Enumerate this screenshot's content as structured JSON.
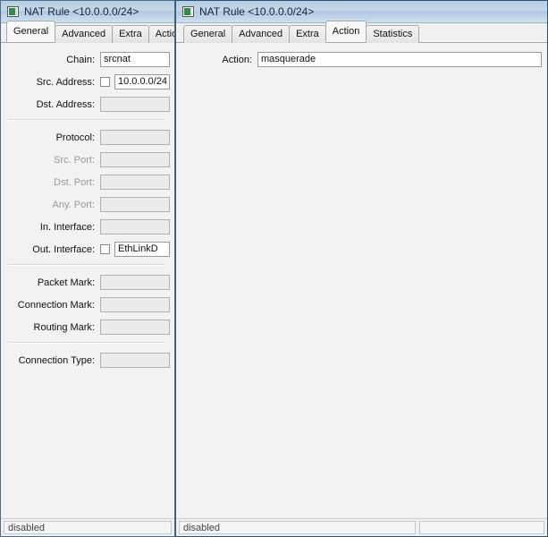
{
  "windows": {
    "left": {
      "title": "NAT Rule <10.0.0.0/24>",
      "icon": "window-icon",
      "tabs": [
        {
          "label": "General",
          "selected": true
        },
        {
          "label": "Advanced",
          "selected": false
        },
        {
          "label": "Extra",
          "selected": false
        },
        {
          "label": "Action",
          "selected": false
        }
      ],
      "fields": [
        {
          "label": "Chain:",
          "value": "srcnat",
          "enabled": true,
          "checkbox": false
        },
        {
          "label": "Src. Address:",
          "value": "10.0.0.0/24",
          "enabled": true,
          "checkbox": true
        },
        {
          "label": "Dst. Address:",
          "value": "",
          "enabled": false,
          "checkbox": false
        },
        {
          "separator": true
        },
        {
          "label": "Protocol:",
          "value": "",
          "enabled": false,
          "checkbox": false
        },
        {
          "label": "Src. Port:",
          "value": "",
          "enabled": false,
          "checkbox": false,
          "dim": true
        },
        {
          "label": "Dst. Port:",
          "value": "",
          "enabled": false,
          "checkbox": false,
          "dim": true
        },
        {
          "label": "Any. Port:",
          "value": "",
          "enabled": false,
          "checkbox": false,
          "dim": true
        },
        {
          "label": "In. Interface:",
          "value": "",
          "enabled": false,
          "checkbox": false
        },
        {
          "label": "Out. Interface:",
          "value": "EthLinkD",
          "enabled": true,
          "checkbox": true
        },
        {
          "separator": true
        },
        {
          "label": "Packet Mark:",
          "value": "",
          "enabled": false,
          "checkbox": false
        },
        {
          "label": "Connection Mark:",
          "value": "",
          "enabled": false,
          "checkbox": false
        },
        {
          "label": "Routing Mark:",
          "value": "",
          "enabled": false,
          "checkbox": false
        },
        {
          "separator": true
        },
        {
          "label": "Connection Type:",
          "value": "",
          "enabled": false,
          "checkbox": false
        }
      ],
      "status": {
        "primary": "disabled"
      }
    },
    "right": {
      "title": "NAT Rule <10.0.0.0/24>",
      "icon": "window-icon",
      "tabs": [
        {
          "label": "General",
          "selected": false
        },
        {
          "label": "Advanced",
          "selected": false
        },
        {
          "label": "Extra",
          "selected": false
        },
        {
          "label": "Action",
          "selected": true
        },
        {
          "label": "Statistics",
          "selected": false
        }
      ],
      "fields": [
        {
          "label": "Action:",
          "value": "masquerade",
          "enabled": true,
          "checkbox": false
        }
      ],
      "status": {
        "primary": "disabled",
        "secondary": ""
      }
    }
  },
  "colors": {
    "titlebar_accent": "#b6cce2",
    "window_border": "#4a6f8a",
    "panel_bg": "#f2f2f2",
    "field_disabled_bg": "#ebebeb",
    "field_enabled_bg": "#ffffff",
    "label_dim": "#9a9a9a"
  }
}
